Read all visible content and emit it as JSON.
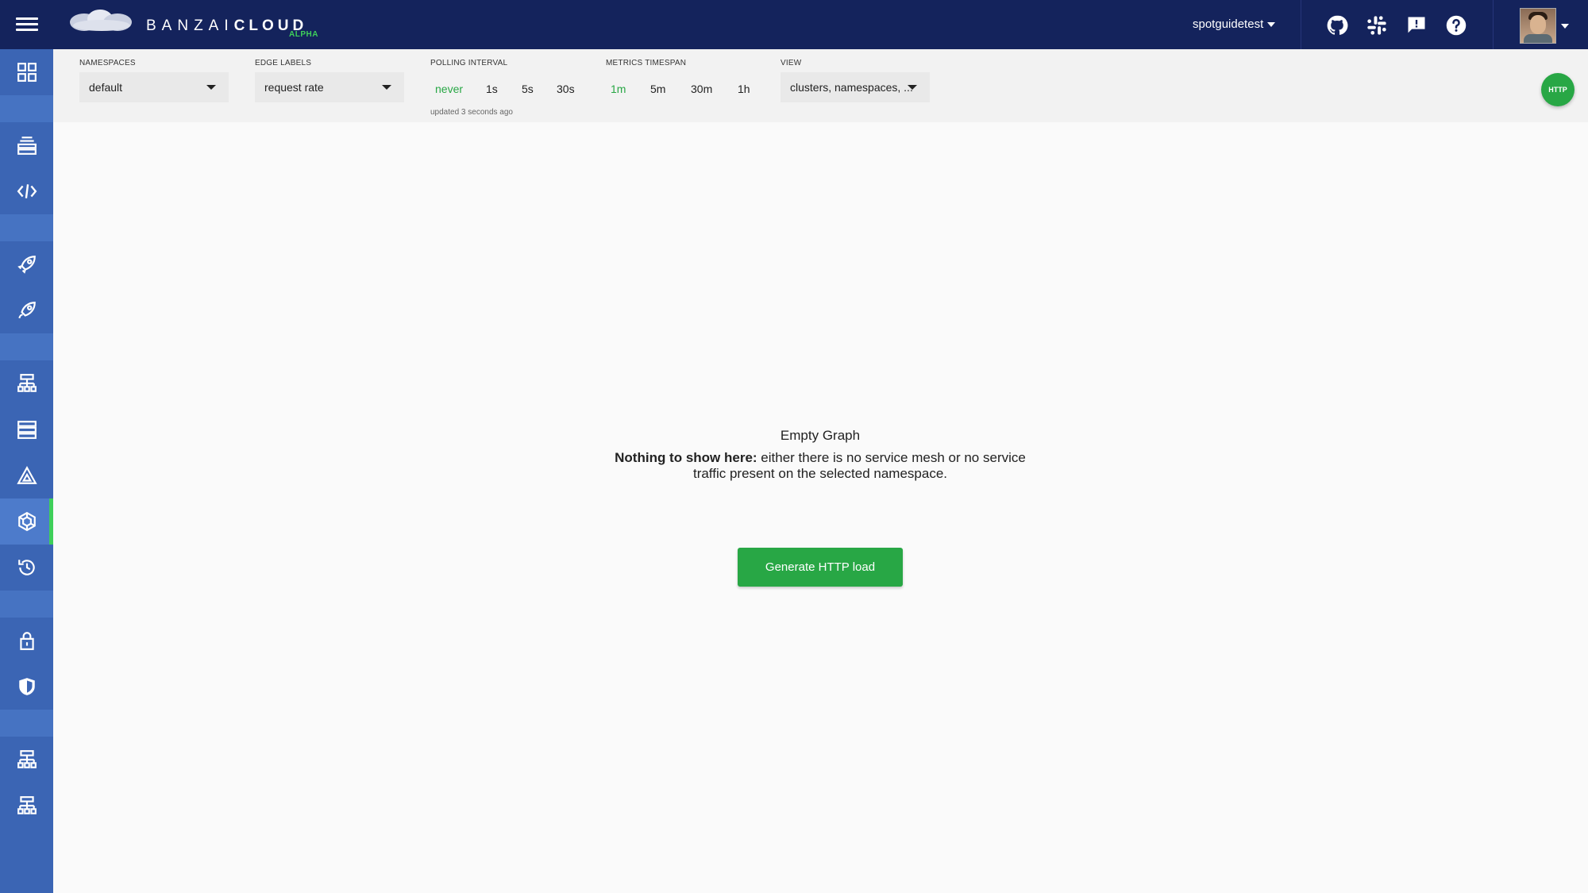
{
  "header": {
    "brand_light": "BANZAI",
    "brand_bold": "CLOUD",
    "brand_tag": "ALPHA",
    "org_name": "spotguidetest",
    "icons": [
      "github-icon",
      "slack-icon",
      "feedback-icon",
      "help-icon"
    ]
  },
  "sidebar": {
    "items": [
      {
        "icon": "dashboard-icon"
      },
      {
        "icon": "layers-icon"
      },
      {
        "icon": "code-icon"
      },
      {
        "icon": "rocket-icon"
      },
      {
        "icon": "rocket-alt-icon"
      },
      {
        "icon": "topology-icon"
      },
      {
        "icon": "list-icon"
      },
      {
        "icon": "pyramid-icon"
      },
      {
        "icon": "service-mesh-icon",
        "active": true
      },
      {
        "icon": "history-icon"
      },
      {
        "icon": "lock-icon"
      },
      {
        "icon": "shield-icon"
      },
      {
        "icon": "network-icon"
      },
      {
        "icon": "network-alt-icon"
      }
    ]
  },
  "filters": {
    "namespaces": {
      "label": "NAMESPACES",
      "value": "default"
    },
    "edge_labels": {
      "label": "EDGE LABELS",
      "value": "request rate"
    },
    "polling": {
      "label": "POLLING INTERVAL",
      "options": [
        "never",
        "1s",
        "5s",
        "30s"
      ],
      "selected": "never",
      "updated": "updated 3 seconds ago"
    },
    "timespan": {
      "label": "METRICS TIMESPAN",
      "options": [
        "1m",
        "5m",
        "30m",
        "1h"
      ],
      "selected": "1m"
    },
    "view": {
      "label": "VIEW",
      "value": "clusters, namespaces, ..."
    }
  },
  "fab": {
    "label": "HTTP"
  },
  "empty": {
    "title": "Empty Graph",
    "message_bold": "Nothing to show here:",
    "message": " either there is no service mesh or no service traffic present on the selected namespace.",
    "button": "Generate HTTP load"
  },
  "colors": {
    "topbar": "#14235c",
    "sidebar": "#3b65b4",
    "accent": "#28a745",
    "active_marker": "#3ecf5a"
  }
}
